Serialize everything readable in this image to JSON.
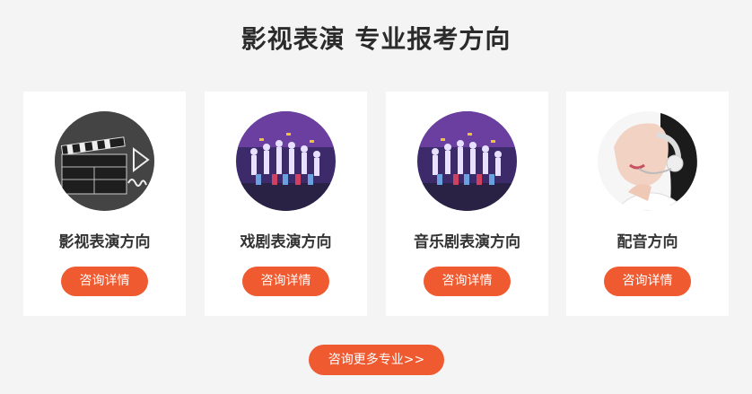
{
  "section": {
    "title": "影视表演 专业报考方向"
  },
  "cards": [
    {
      "label": "影视表演方向",
      "button": "咨询详情",
      "image_icon": "clapperboard-play-icon"
    },
    {
      "label": "戏剧表演方向",
      "button": "咨询详情",
      "image_icon": "stage-performance-icon"
    },
    {
      "label": "音乐剧表演方向",
      "button": "咨询详情",
      "image_icon": "stage-performance-icon"
    },
    {
      "label": "配音方向",
      "button": "咨询详情",
      "image_icon": "headset-voice-actor-icon"
    }
  ],
  "more_button": "咨询更多专业>>",
  "colors": {
    "accent": "#ef5a30",
    "background": "#f4f4f4",
    "card": "#ffffff"
  }
}
